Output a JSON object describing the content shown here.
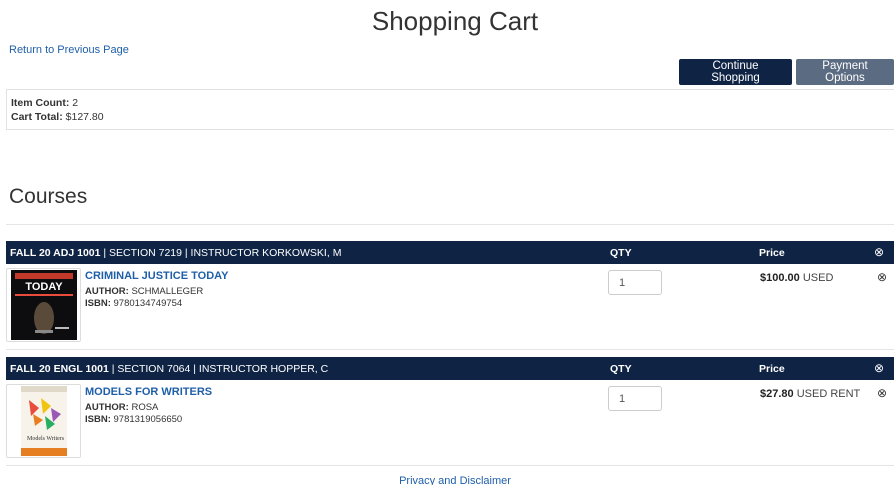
{
  "page": {
    "title": "Shopping Cart",
    "back_link": "Return to Previous Page"
  },
  "buttons": {
    "continue_shopping": "Continue Shopping",
    "payment_options": "Payment Options"
  },
  "summary": {
    "item_count_label": "Item Count:",
    "item_count_value": "2",
    "cart_total_label": "Cart Total:",
    "cart_total_value": "$127.80"
  },
  "courses_heading": "Courses",
  "columns": {
    "qty": "QTY",
    "price": "Price"
  },
  "courses": [
    {
      "course": "FALL 20 ADJ 1001",
      "details": " | SECTION 7219 | INSTRUCTOR KORKOWSKI, M",
      "book": {
        "title": "CRIMINAL JUSTICE TODAY",
        "author_label": "AUTHOR:",
        "author": "SCHMALLEGER",
        "isbn_label": "ISBN:",
        "isbn": "9780134749754",
        "qty": "1",
        "price": "$100.00",
        "condition": "USED",
        "cover_text": "TODAY"
      }
    },
    {
      "course": "FALL 20 ENGL 1001",
      "details": " | SECTION 7064 | INSTRUCTOR HOPPER, C",
      "book": {
        "title": "MODELS FOR WRITERS",
        "author_label": "AUTHOR:",
        "author": "ROSA",
        "isbn_label": "ISBN:",
        "isbn": "9781319056650",
        "qty": "1",
        "price": "$27.80",
        "condition": "USED RENT",
        "cover_text": "Models Writers"
      }
    }
  ],
  "icons": {
    "remove": "remove-circle-icon"
  },
  "colors": {
    "navy": "#0f2445",
    "slate_button": "#5b6b82",
    "link_blue": "#1f5fa8"
  },
  "footer": {
    "privacy": "Privacy and Disclaimer"
  }
}
